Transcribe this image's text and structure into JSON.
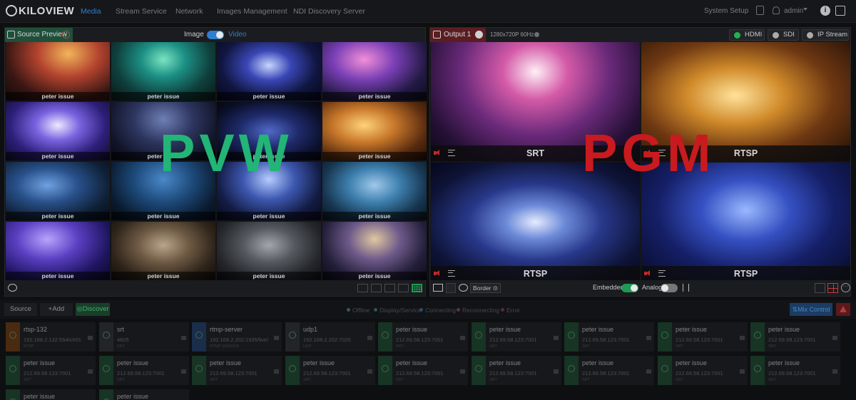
{
  "nav": {
    "logo": "KILOVIEW",
    "items": [
      "Media",
      "Stream Service",
      "Network",
      "Images Management",
      "NDI Discovery Server"
    ],
    "system_setup": "System Setup",
    "user": "admin"
  },
  "preview": {
    "tab_label": "Source Preview",
    "toggle_left": "Image",
    "toggle_right": "Video",
    "overlay": "PVW",
    "cells": [
      "peter issue",
      "peter issue",
      "peter issue",
      "peter issue",
      "peter issue",
      "peter issue",
      "peter issue",
      "peter issue",
      "peter issue",
      "peter issue",
      "peter issue",
      "peter issue",
      "peter issue",
      "peter issue",
      "peter issue",
      "peter issue"
    ]
  },
  "output": {
    "tab_label": "Output 1",
    "resolution": "1280x720P 60Hz",
    "outputs": [
      "HDMI",
      "SDI",
      "IP Stream"
    ],
    "overlay": "PGM",
    "cells": [
      "SRT",
      "RTSP",
      "RTSP",
      "RTSP"
    ],
    "border_label": "Border",
    "embedded_label": "Embedded",
    "analog_label": "Analog"
  },
  "sources_bar": {
    "source_label": "Source",
    "add_label": "+Add",
    "discover_label": "Discover",
    "legend": [
      "Offline",
      "Display/Service",
      "Connecting",
      "Reconnecting",
      "Error"
    ],
    "legend_colors": [
      "#3a5a44",
      "#2a5a3a",
      "#2a4a6a",
      "#5a3a2a",
      "#5a2a2a"
    ],
    "mix_label": "Mix Control"
  },
  "cards": [
    {
      "name": "rtsp-132",
      "addr": "192.168.2.132:554/ch01",
      "sub": "RTSP"
    },
    {
      "name": "srt",
      "addr": "4825",
      "sub": "SRT"
    },
    {
      "name": "rtmp-server",
      "addr": "192.168.2.202:1935/live/",
      "sub": "RTMP SESSION"
    },
    {
      "name": "udp1",
      "addr": "192.168.2.202:7020",
      "sub": "UDP"
    },
    {
      "name": "peter issue",
      "addr": "212.69.58.123:7001",
      "sub": "SRT"
    },
    {
      "name": "peter issue",
      "addr": "212.69.58.123:7001",
      "sub": "SRT"
    },
    {
      "name": "peter issue",
      "addr": "212.69.58.123:7001",
      "sub": "SRT"
    },
    {
      "name": "peter issue",
      "addr": "212.69.58.123:7001",
      "sub": "SRT"
    },
    {
      "name": "peter issue",
      "addr": "212.69.58.123:7001",
      "sub": "SRT"
    },
    {
      "name": "peter issue",
      "addr": "212.69.58.123:7001",
      "sub": "SRT"
    },
    {
      "name": "peter issue",
      "addr": "212.69.58.123:7001",
      "sub": "SRT"
    },
    {
      "name": "peter issue",
      "addr": "212.69.58.123:7001",
      "sub": "SRT"
    },
    {
      "name": "peter issue",
      "addr": "212.69.58.123:7001",
      "sub": "SRT"
    },
    {
      "name": "peter issue",
      "addr": "212.69.58.123:7001",
      "sub": "SRT"
    },
    {
      "name": "peter issue",
      "addr": "212.69.58.123:7001",
      "sub": "SRT"
    },
    {
      "name": "peter issue",
      "addr": "212.69.58.123:7001",
      "sub": "SRT"
    },
    {
      "name": "peter issue",
      "addr": "212.69.58.123:7001",
      "sub": "SRT"
    },
    {
      "name": "peter issue",
      "addr": "212.69.58.123:7001",
      "sub": "SRT"
    },
    {
      "name": "peter issue",
      "addr": "",
      "sub": ""
    },
    {
      "name": "peter issue",
      "addr": "",
      "sub": ""
    }
  ]
}
